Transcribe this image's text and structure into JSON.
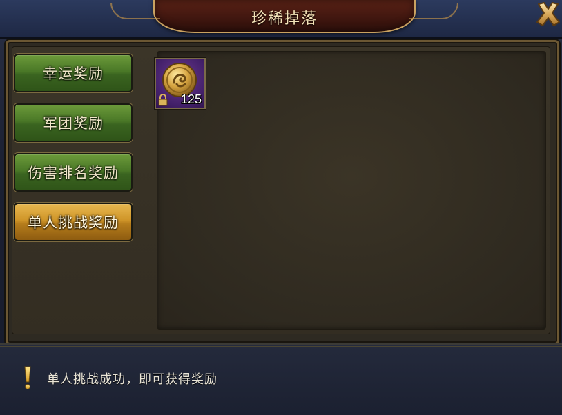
{
  "window": {
    "title": "珍稀掉落"
  },
  "tabs": [
    {
      "label": "幸运奖励",
      "state": "inactive"
    },
    {
      "label": "军团奖励",
      "state": "inactive"
    },
    {
      "label": "伤害排名奖励",
      "state": "inactive"
    },
    {
      "label": "单人挑战奖励",
      "state": "active"
    }
  ],
  "items": [
    {
      "icon": "gold-coin-icon",
      "count": "125",
      "locked": true,
      "rarity_color": "#5a2c82"
    }
  ],
  "footer": {
    "hint": "单人挑战成功，即可获得奖励"
  },
  "colors": {
    "tab_inactive": "#4a7827",
    "tab_active": "#cf9528",
    "title_plate": "#4a1a12",
    "frame_gold": "#c4a163"
  }
}
